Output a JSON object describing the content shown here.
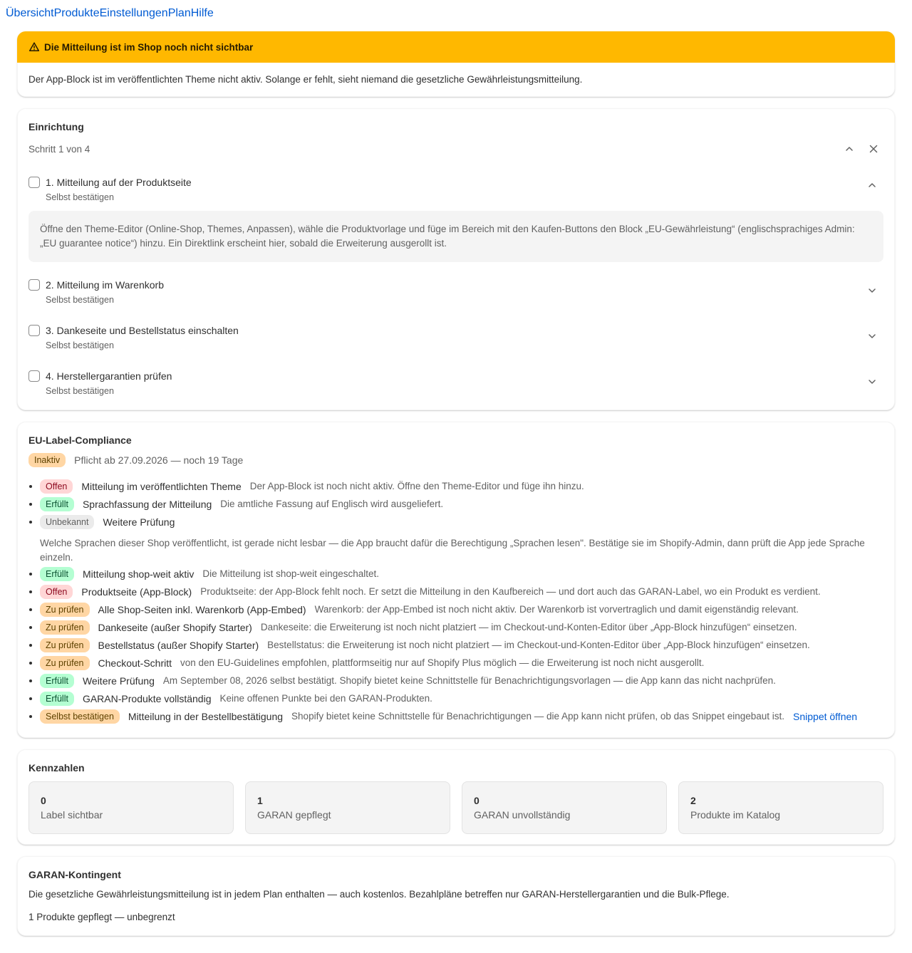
{
  "nav": [
    "Übersicht",
    "Produkte",
    "Einstellungen",
    "Plan",
    "Hilfe"
  ],
  "banner": {
    "title": "Die Mitteilung ist im Shop noch nicht sichtbar",
    "body": "Der App-Block ist im veröffentlichten Theme nicht aktiv. Solange er fehlt, sieht niemand die gesetzliche Gewährleistungsmitteilung."
  },
  "setup": {
    "title": "Einrichtung",
    "progress": "Schritt 1 von 4",
    "steps": [
      {
        "label": "1. Mitteilung auf der Produktseite",
        "hint": "Selbst bestätigen",
        "expanded": true,
        "detail": "Öffne den Theme-Editor (Online-Shop, Themes, Anpassen), wähle die Produktvorlage und füge im Bereich mit den Kaufen-Buttons den Block „EU-Gewährleistung“ (englischsprachiges Admin: „EU guarantee notice“) hinzu. Ein Direktlink erscheint hier, sobald die Erweiterung ausgerollt ist."
      },
      {
        "label": "2. Mitteilung im Warenkorb",
        "hint": "Selbst bestätigen",
        "expanded": false
      },
      {
        "label": "3. Dankeseite und Bestellstatus einschalten",
        "hint": "Selbst bestätigen",
        "expanded": false
      },
      {
        "label": "4. Herstellergarantien prüfen",
        "hint": "Selbst bestätigen",
        "expanded": false
      }
    ]
  },
  "compliance": {
    "title": "EU-Label-Compliance",
    "status_badge": "Inaktiv",
    "deadline": "Pflicht ab 27.09.2026 — noch 19 Tage",
    "items": [
      {
        "badge": "Offen",
        "kind": "offen",
        "name": "Mitteilung im veröffentlichten Theme",
        "desc": "Der App-Block ist noch nicht aktiv. Öffne den Theme-Editor und füge ihn hinzu."
      },
      {
        "badge": "Erfüllt",
        "kind": "erfuellt",
        "name": "Sprachfassung der Mitteilung",
        "desc": "Die amtliche Fassung auf Englisch wird ausgeliefert."
      },
      {
        "badge": "Unbekannt",
        "kind": "unbekannt",
        "name": "Weitere Prüfung",
        "desc": ""
      },
      {
        "note": "Welche Sprachen dieser Shop veröffentlicht, ist gerade nicht lesbar — die App braucht dafür die Berechtigung „Sprachen lesen\". Bestätige sie im Shopify-Admin, dann prüft die App jede Sprache einzeln."
      },
      {
        "badge": "Erfüllt",
        "kind": "erfuellt",
        "name": "Mitteilung shop-weit aktiv",
        "desc": "Die Mitteilung ist shop-weit eingeschaltet."
      },
      {
        "badge": "Offen",
        "kind": "offen",
        "name": "Produktseite (App-Block)",
        "desc": "Produktseite: der App-Block fehlt noch. Er setzt die Mitteilung in den Kaufbereich — und dort auch das GARAN-Label, wo ein Produkt es verdient."
      },
      {
        "badge": "Zu prüfen",
        "kind": "pruefen",
        "name": "Alle Shop-Seiten inkl. Warenkorb (App-Embed)",
        "desc": "Warenkorb: der App-Embed ist noch nicht aktiv. Der Warenkorb ist vorvertraglich und damit eigenständig relevant."
      },
      {
        "badge": "Zu prüfen",
        "kind": "pruefen",
        "name": "Dankeseite (außer Shopify Starter)",
        "desc": "Dankeseite: die Erweiterung ist noch nicht platziert — im Checkout-und-Konten-Editor über „App-Block hinzufügen“ einsetzen."
      },
      {
        "badge": "Zu prüfen",
        "kind": "pruefen",
        "name": "Bestellstatus (außer Shopify Starter)",
        "desc": "Bestellstatus: die Erweiterung ist noch nicht platziert — im Checkout-und-Konten-Editor über „App-Block hinzufügen“ einsetzen."
      },
      {
        "badge": "Zu prüfen",
        "kind": "pruefen",
        "name": "Checkout-Schritt",
        "desc": "von den EU-Guidelines empfohlen, plattformseitig nur auf Shopify Plus möglich — die Erweiterung ist noch nicht ausgerollt."
      },
      {
        "badge": "Erfüllt",
        "kind": "erfuellt",
        "name": "Weitere Prüfung",
        "desc": "Am September 08, 2026 selbst bestätigt. Shopify bietet keine Schnittstelle für Benachrichtigungsvorlagen — die App kann das nicht nachprüfen."
      },
      {
        "badge": "Erfüllt",
        "kind": "erfuellt",
        "name": "GARAN-Produkte vollständig",
        "desc": "Keine offenen Punkte bei den GARAN-Produkten."
      },
      {
        "badge": "Selbst bestätigen",
        "kind": "pruefen",
        "name": "Mitteilung in der Bestellbestätigung",
        "desc": "Shopify bietet keine Schnittstelle für Benachrichtigungen — die App kann nicht prüfen, ob das Snippet eingebaut ist.",
        "link": "Snippet öffnen"
      }
    ]
  },
  "metrics": {
    "title": "Kennzahlen",
    "items": [
      {
        "value": "0",
        "label": "Label sichtbar"
      },
      {
        "value": "1",
        "label": "GARAN gepflegt"
      },
      {
        "value": "0",
        "label": "GARAN unvollständig"
      },
      {
        "value": "2",
        "label": "Produkte im Katalog"
      }
    ]
  },
  "quota": {
    "title": "GARAN-Kontingent",
    "text": "Die gesetzliche Gewährleistungsmitteilung ist in jedem Plan enthalten — auch kostenlos. Bezahlpläne betreffen nur GARAN-Herstellergarantien und die Bulk-Pflege.",
    "usage": "1 Produkte gepflegt — unbegrenzt"
  }
}
